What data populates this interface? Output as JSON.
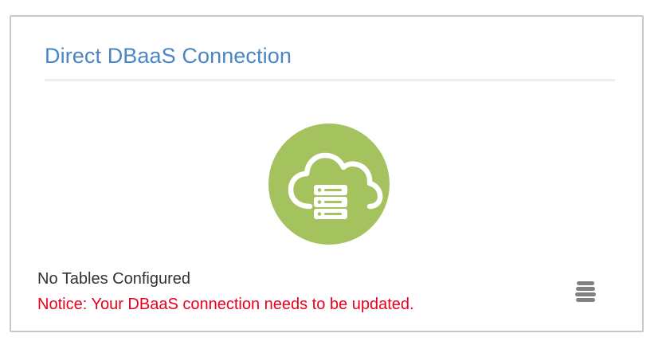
{
  "card": {
    "title": "Direct DBaaS Connection",
    "icon": "cloud-database-icon",
    "status": "No Tables Configured",
    "notice": "Notice: Your DBaaS connection needs to be updated.",
    "menu_icon": "stacked-menu-icon"
  },
  "colors": {
    "title": "#4a86c5",
    "icon_background": "#a4c25e",
    "notice": "#e8001c",
    "status_text": "#333333",
    "card_border": "#c6c8cb",
    "menu_icon": "#7f8182"
  }
}
